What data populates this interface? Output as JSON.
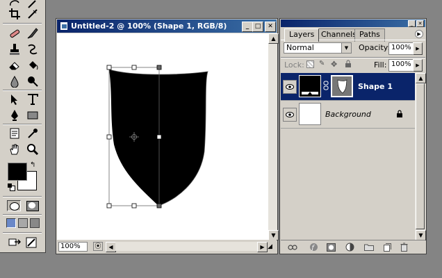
{
  "document": {
    "title": "Untitled-2 @ 100% (Shape 1, RGB/8)",
    "zoom": "100%",
    "buttons": {
      "minimize": "_",
      "maximize": "□",
      "close": "✕"
    }
  },
  "layers_panel": {
    "tabs": [
      {
        "label": "Layers",
        "active": true
      },
      {
        "label": "Channels",
        "active": false
      },
      {
        "label": "Paths",
        "active": false
      }
    ],
    "blend_mode": "Normal",
    "opacity_label": "Opacity:",
    "opacity_value": "100%",
    "lock_label": "Lock:",
    "fill_label": "Fill:",
    "fill_value": "100%",
    "layers": [
      {
        "name": "Shape 1",
        "selected": true,
        "visible": true
      },
      {
        "name": "Background",
        "selected": false,
        "visible": true,
        "locked": true
      }
    ]
  },
  "toolbox": {
    "foreground_color": "#000000",
    "background_color": "#ffffff"
  }
}
